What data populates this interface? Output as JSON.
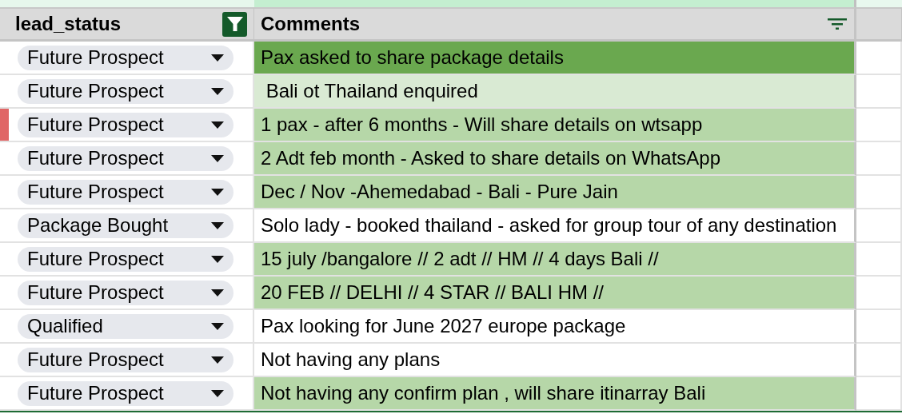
{
  "columns": [
    {
      "label": "lead_status",
      "filter_active": true
    },
    {
      "label": "Comments",
      "filter_active": false
    }
  ],
  "rows": [
    {
      "status": "Future Prospect",
      "comment": {
        "text": "Pax asked to share package details",
        "color": "#6aa84f"
      }
    },
    {
      "status": "Future Prospect",
      "comment": {
        "text": " Bali ot Thailand enquired",
        "color": "#d9ead3"
      }
    },
    {
      "status": "Future Prospect",
      "edge": {
        "color": "#e06666"
      },
      "comment": {
        "text": "1 pax - after 6 months - Will share details on wtsapp",
        "color": "#b6d7a8"
      }
    },
    {
      "status": "Future Prospect",
      "comment": {
        "text": "2 Adt feb month - Asked to share details on WhatsApp",
        "color": "#b6d7a8"
      }
    },
    {
      "status": "Future Prospect",
      "comment": {
        "text": "Dec / Nov -Ahemedabad - Bali - Pure Jain",
        "color": "#b6d7a8"
      }
    },
    {
      "status": "Package Bought",
      "comment": {
        "text": "Solo lady - booked thailand - asked for group tour of any destination",
        "color": "#ffffff"
      }
    },
    {
      "status": "Future Prospect",
      "comment": {
        "text": "15 july /bangalore // 2 adt // HM // 4 days Bali //",
        "color": "#b6d7a8"
      }
    },
    {
      "status": "Future Prospect",
      "comment": {
        "text": "20 FEB // DELHI // 4 STAR // BALI HM //",
        "color": "#b6d7a8"
      }
    },
    {
      "status": "Qualified",
      "comment": {
        "text": "Pax looking for June 2027 europe package",
        "color": "#ffffff"
      }
    },
    {
      "status": "Future Prospect",
      "comment": {
        "text": "Not having any plans",
        "color": "#ffffff"
      }
    },
    {
      "status": "Future Prospect",
      "comment": {
        "text": "Not having any confirm plan , will share itinarray Bali",
        "color": "#b6d7a8"
      }
    }
  ]
}
